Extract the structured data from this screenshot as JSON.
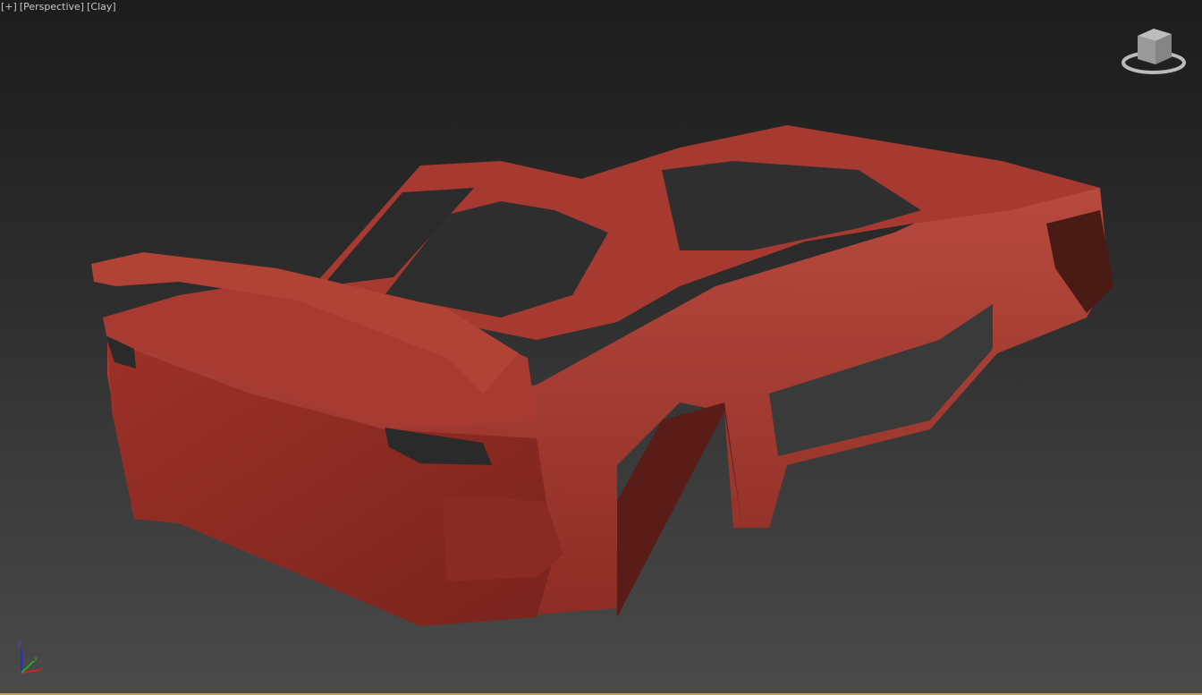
{
  "viewport": {
    "menu_plus": "[+]",
    "view_mode": "[Perspective]",
    "shading_mode": "[Clay]"
  },
  "axis_gizmo": {
    "z": "z",
    "x": "x",
    "y": "y"
  },
  "colors": {
    "clay": "#a63a30",
    "clay_dark": "#6e231d",
    "clay_light": "#c0544a",
    "accent_border": "#b9a24a"
  }
}
